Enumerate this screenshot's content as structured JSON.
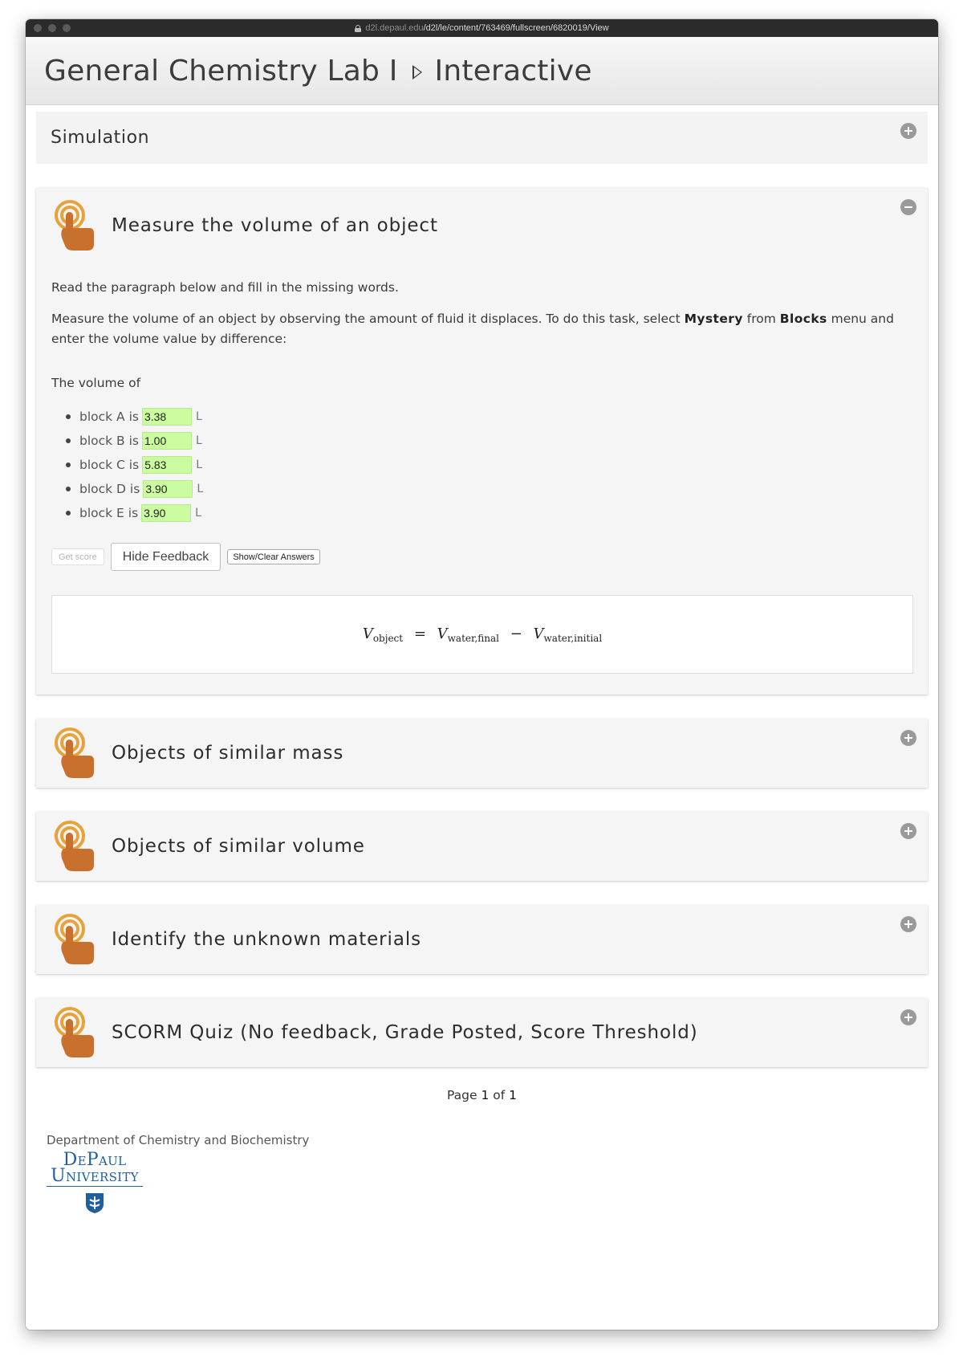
{
  "browser": {
    "url_domain": "d2l.depaul.edu",
    "url_path": "/d2l/le/content/763469/fullscreen/6820019/View"
  },
  "header": {
    "course": "General Chemistry Lab I",
    "section": "Interactive"
  },
  "simulation_panel": {
    "title": "Simulation",
    "state": "collapsed"
  },
  "activity_open": {
    "title": "Measure the volume of an object",
    "state": "expanded",
    "instruction": "Read the paragraph below and fill in the missing words.",
    "task_part1": "Measure the volume of an object by observing the amount of fluid it displaces. To do this task, select ",
    "task_term1": "Mystery",
    "task_part2": " from ",
    "task_term2": "Blocks",
    "task_part3": " menu and enter the volume value by difference:",
    "volume_intro": "The volume of",
    "blocks": [
      {
        "label": "block A is",
        "value": "3.38",
        "unit": "L"
      },
      {
        "label": "block B is",
        "value": "1.00",
        "unit": "L"
      },
      {
        "label": "block C is",
        "value": "5.83",
        "unit": "L"
      },
      {
        "label": "block D is",
        "value": "3.90",
        "unit": "L"
      },
      {
        "label": "block E is",
        "value": "3.90",
        "unit": "L"
      }
    ],
    "input_color": "#ccfca0",
    "buttons": {
      "get_score": "Get score",
      "hide_feedback": "Hide Feedback",
      "show_clear": "Show/Clear Answers"
    },
    "formula": {
      "lhs_var": "V",
      "lhs_sub": "object",
      "eq": "=",
      "t1_var": "V",
      "t1_sub": "water,final",
      "minus": "−",
      "t2_var": "V",
      "t2_sub": "water,initial"
    }
  },
  "activities_collapsed": [
    {
      "title": "Objects of similar mass",
      "state": "collapsed"
    },
    {
      "title": "Objects of similar volume",
      "state": "collapsed"
    },
    {
      "title": "Identify the unknown materials",
      "state": "collapsed"
    },
    {
      "title": "SCORM Quiz (No feedback, Grade Posted, Score Threshold)",
      "state": "collapsed"
    }
  ],
  "pager": {
    "prefix": "Page",
    "current": "1",
    "of": "of",
    "total": "1"
  },
  "footer": {
    "department": "Department of Chemistry and Biochemistry",
    "logo_line1": "DePaul",
    "logo_line2": "University"
  },
  "colors": {
    "hand_icon": "#c8702e",
    "hand_rings": "#e8a23a",
    "logo_blue": "#1f5f9e"
  },
  "icons": {
    "toggle_expanded": "minus-circle-icon",
    "toggle_collapsed": "plus-circle-icon",
    "activity": "touch-hand-icon"
  }
}
